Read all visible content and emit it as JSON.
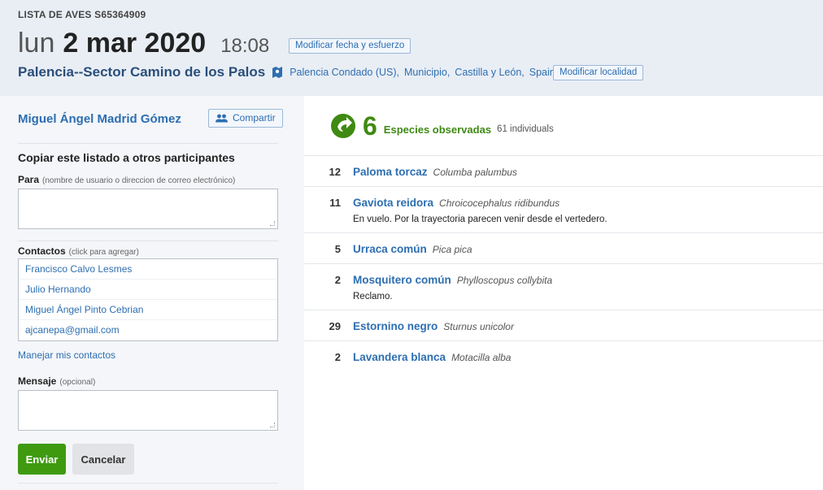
{
  "header": {
    "list_id": "LISTA DE AVES S65364909",
    "day": "lun",
    "date": "2 mar 2020",
    "time": "18:08",
    "edit_date_button": "Modificar fecha y esfuerzo",
    "location_name": "Palencia--Sector Camino de los Palos",
    "location_parts": [
      "Palencia Condado (US),",
      "Municipio,",
      "Castilla y León,",
      "Spain"
    ],
    "edit_location_button": "Modificar localidad"
  },
  "share_panel": {
    "user_name": "Miguel Ángel Madrid Gómez",
    "share_button": "Compartir",
    "copy_title": "Copiar este listado a otros participantes",
    "to_label": "Para",
    "to_hint": "(nombre de usuario o direccion de correo electrónico)",
    "to_value": "",
    "contacts_label": "Contactos",
    "contacts_hint": "(click para agregar)",
    "contacts": [
      "Francisco Calvo Lesmes",
      "Julio Hernando",
      "Miguel Ángel Pinto Cebrian",
      "ajcanepa@gmail.com"
    ],
    "manage_contacts_link": "Manejar mis contactos",
    "message_label": "Mensaje",
    "message_hint": "(opcional)",
    "message_value": "",
    "send_button": "Enviar",
    "cancel_button": "Cancelar"
  },
  "summary": {
    "species_count": "6",
    "species_label": "Especies observadas",
    "individuals": "61 individuals"
  },
  "observations": [
    {
      "count": "12",
      "common": "Paloma torcaz",
      "scientific": "Columba palumbus",
      "comment": ""
    },
    {
      "count": "11",
      "common": "Gaviota reidora",
      "scientific": "Chroicocephalus ridibundus",
      "comment": "En vuelo. Por la trayectoria parecen venir desde el vertedero."
    },
    {
      "count": "5",
      "common": "Urraca común",
      "scientific": "Pica pica",
      "comment": ""
    },
    {
      "count": "2",
      "common": "Mosquitero común",
      "scientific": "Phylloscopus collybita",
      "comment": "Reclamo."
    },
    {
      "count": "29",
      "common": "Estornino negro",
      "scientific": "Sturnus unicolor",
      "comment": ""
    },
    {
      "count": "2",
      "common": "Lavandera blanca",
      "scientific": "Motacilla alba",
      "comment": ""
    }
  ],
  "colors": {
    "header_bg": "#e9eef5",
    "link_blue": "#2d6eb1",
    "species_green": "#3f8a12",
    "send_green": "#3f9a10"
  },
  "icons": {
    "map": "map-icon",
    "share": "people-icon",
    "species": "species-icon"
  }
}
